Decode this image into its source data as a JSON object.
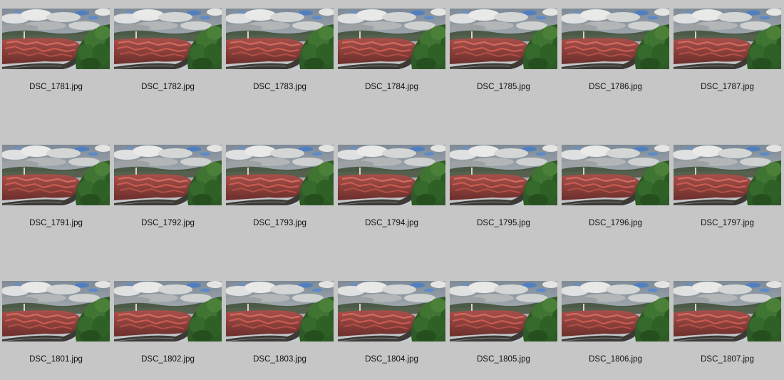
{
  "colors": {
    "background": "#c6c6c6",
    "caption_text": "#101010"
  },
  "thumbnail_icon": "landscape-photo-thumbnail-icon",
  "grid": {
    "rows": [
      {
        "items": [
          {
            "filename": "DSC_1781.jpg"
          },
          {
            "filename": "DSC_1782.jpg"
          },
          {
            "filename": "DSC_1783.jpg"
          },
          {
            "filename": "DSC_1784.jpg"
          },
          {
            "filename": "DSC_1785.jpg"
          },
          {
            "filename": "DSC_1786.jpg"
          },
          {
            "filename": "DSC_1787.jpg"
          }
        ]
      },
      {
        "items": [
          {
            "filename": "DSC_1791.jpg"
          },
          {
            "filename": "DSC_1792.jpg"
          },
          {
            "filename": "DSC_1793.jpg"
          },
          {
            "filename": "DSC_1794.jpg"
          },
          {
            "filename": "DSC_1795.jpg"
          },
          {
            "filename": "DSC_1796.jpg"
          },
          {
            "filename": "DSC_1797.jpg"
          }
        ]
      },
      {
        "items": [
          {
            "filename": "DSC_1801.jpg"
          },
          {
            "filename": "DSC_1802.jpg"
          },
          {
            "filename": "DSC_1803.jpg"
          },
          {
            "filename": "DSC_1804.jpg"
          },
          {
            "filename": "DSC_1805.jpg"
          },
          {
            "filename": "DSC_1806.jpg"
          },
          {
            "filename": "DSC_1807.jpg"
          }
        ]
      }
    ]
  }
}
